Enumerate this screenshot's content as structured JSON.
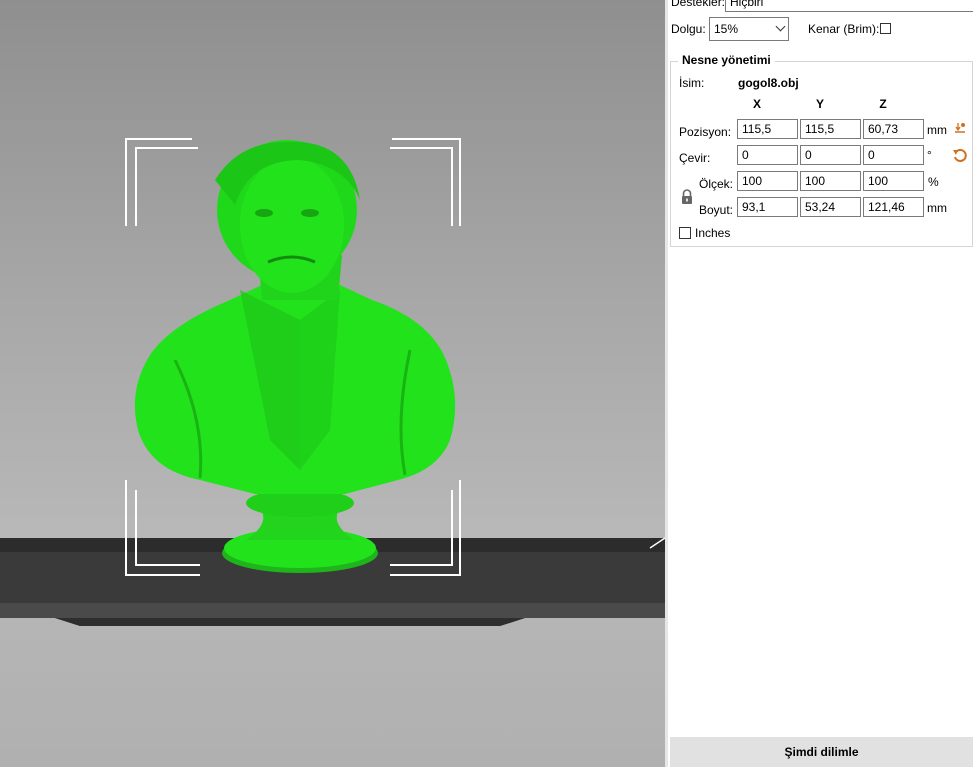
{
  "panel": {
    "supports_label": "Destekler:",
    "supports_value": "Hiçbiri",
    "infill_label": "Dolgu:",
    "infill_value": "15%",
    "brim_label": "Kenar (Brim):",
    "brim_checked": false,
    "object_group_title": "Nesne yönetimi",
    "name_label": "İsim:",
    "name_value": "gogol8.obj",
    "axes": [
      "X",
      "Y",
      "Z"
    ],
    "position_label": "Pozisyon:",
    "position": [
      "115,5",
      "115,5",
      "60,73"
    ],
    "position_unit": "mm",
    "rotate_label": "Çevir:",
    "rotate": [
      "0",
      "0",
      "0"
    ],
    "rotate_unit": "°",
    "scale_label": "Ölçek:",
    "scale": [
      "100",
      "100",
      "100"
    ],
    "scale_unit": "%",
    "size_label": "Boyut:",
    "size": [
      "93,1",
      "53,24",
      "121,46"
    ],
    "size_unit": "mm",
    "inches_label": "Inches",
    "inches_checked": false,
    "slice_button": "Şimdi dilimle"
  },
  "viewport": {
    "model_color": "#22e21c",
    "icons": [
      "drop-to-bed-icon",
      "reset-rotation-icon",
      "lock-icon"
    ]
  }
}
